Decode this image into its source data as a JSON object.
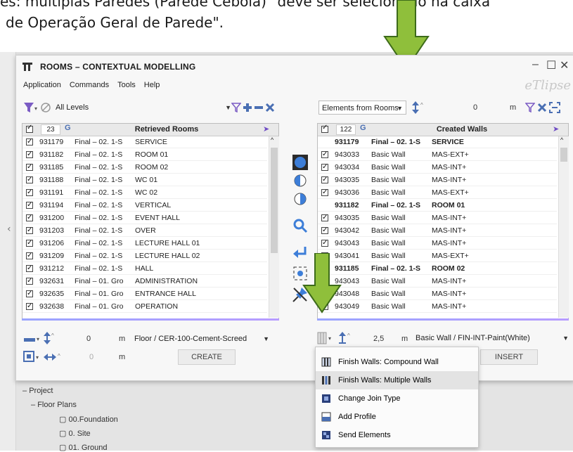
{
  "background": {
    "top_text": "es: múltiplas Paredes (Parede Cebola)\" deve ser selecionado na caixa",
    "second_text": "de Operação Geral de Parede\"."
  },
  "colors": {
    "accent": "#4a6fb3",
    "arrow_fill": "#8fbf3b",
    "arrow_stroke": "#3d6b1a",
    "selected_band": "#b7a3ff",
    "menu_highlight": "#e3e3e3"
  },
  "window": {
    "title": "ROOMS – CONTEXTUAL MODELLING",
    "brand": "eTlipse",
    "controls": {
      "minimize": "–",
      "maximize": "☐",
      "close": "✕"
    },
    "menu": [
      "Application",
      "Commands",
      "Tools",
      "Help"
    ]
  },
  "left": {
    "level_select": "All Levels",
    "count": "23",
    "header_title": "Retrieved Rooms",
    "rows": [
      {
        "id": "931179",
        "level": "Final – 02. 1-S",
        "name": "SERVICE"
      },
      {
        "id": "931182",
        "level": "Final – 02. 1-S",
        "name": "ROOM 01"
      },
      {
        "id": "931185",
        "level": "Final – 02. 1-S",
        "name": "ROOM 02"
      },
      {
        "id": "931188",
        "level": "Final – 02. 1-S",
        "name": "WC 01"
      },
      {
        "id": "931191",
        "level": "Final – 02. 1-S",
        "name": "WC 02"
      },
      {
        "id": "931194",
        "level": "Final – 02. 1-S",
        "name": "VERTICAL"
      },
      {
        "id": "931200",
        "level": "Final – 02. 1-S",
        "name": "EVENT HALL"
      },
      {
        "id": "931203",
        "level": "Final – 02. 1-S",
        "name": "OVER"
      },
      {
        "id": "931206",
        "level": "Final – 02. 1-S",
        "name": "LECTURE HALL 01"
      },
      {
        "id": "931209",
        "level": "Final – 02. 1-S",
        "name": "LECTURE HALL 02"
      },
      {
        "id": "931212",
        "level": "Final – 02. 1-S",
        "name": "HALL"
      },
      {
        "id": "932631",
        "level": "Final – 01. Gro",
        "name": "ADMINISTRATION"
      },
      {
        "id": "932635",
        "level": "Final – 01. Gro",
        "name": "ENTRANCE HALL"
      },
      {
        "id": "932638",
        "level": "Final – 01. Gro",
        "name": "OPERATION"
      }
    ],
    "offset_value": "0",
    "offset_unit": "m",
    "floor_type": "Floor / CER-100-Cement-Screed",
    "width_value": "0",
    "width_unit": "m",
    "create_label": "CREATE"
  },
  "right": {
    "elements_select": "Elements from Rooms",
    "height_value": "0",
    "height_unit": "m",
    "count": "122",
    "header_title": "Created Walls",
    "rows": [
      {
        "group": true,
        "id": "931179",
        "type": "Final – 02. 1-S",
        "name": "SERVICE"
      },
      {
        "id": "943033",
        "type": "Basic Wall",
        "name": "MAS-EXT+"
      },
      {
        "id": "943034",
        "type": "Basic Wall",
        "name": "MAS-INT+"
      },
      {
        "id": "943035",
        "type": "Basic Wall",
        "name": "MAS-INT+"
      },
      {
        "id": "943036",
        "type": "Basic Wall",
        "name": "MAS-EXT+"
      },
      {
        "group": true,
        "id": "931182",
        "type": "Final – 02. 1-S",
        "name": "ROOM 01"
      },
      {
        "id": "943035",
        "type": "Basic Wall",
        "name": "MAS-INT+"
      },
      {
        "id": "943042",
        "type": "Basic Wall",
        "name": "MAS-INT+"
      },
      {
        "id": "943043",
        "type": "Basic Wall",
        "name": "MAS-INT+"
      },
      {
        "id": "943041",
        "type": "Basic Wall",
        "name": "MAS-EXT+"
      },
      {
        "group": true,
        "id": "931185",
        "type": "Final – 02. 1-S",
        "name": "ROOM 02"
      },
      {
        "id": "943043",
        "type": "Basic Wall",
        "name": "MAS-INT+"
      },
      {
        "id": "943048",
        "type": "Basic Wall",
        "name": "MAS-INT+"
      },
      {
        "id": "943049",
        "type": "Basic Wall",
        "name": "MAS-INT+"
      }
    ],
    "offset_value": "2,5",
    "offset_unit": "m",
    "wall_type": "Basic Wall / FIN-INT-Paint(White)",
    "insert_label": "INSERT"
  },
  "dropdown_menu": [
    {
      "label": "Finish Walls: Compound Wall",
      "icon": "compound-wall-icon"
    },
    {
      "label": "Finish Walls: Multiple Walls",
      "icon": "multiple-walls-icon",
      "highlighted": true
    },
    {
      "label": "Change Join Type",
      "icon": "join-type-icon"
    },
    {
      "label": "Add Profile",
      "icon": "profile-icon"
    },
    {
      "label": "Send Elements",
      "icon": "send-elements-icon"
    }
  ],
  "tree": {
    "project": "Project",
    "floor_plans": "Floor Plans",
    "items": [
      "00.Foundation",
      "0. Site",
      "01. Ground"
    ]
  }
}
